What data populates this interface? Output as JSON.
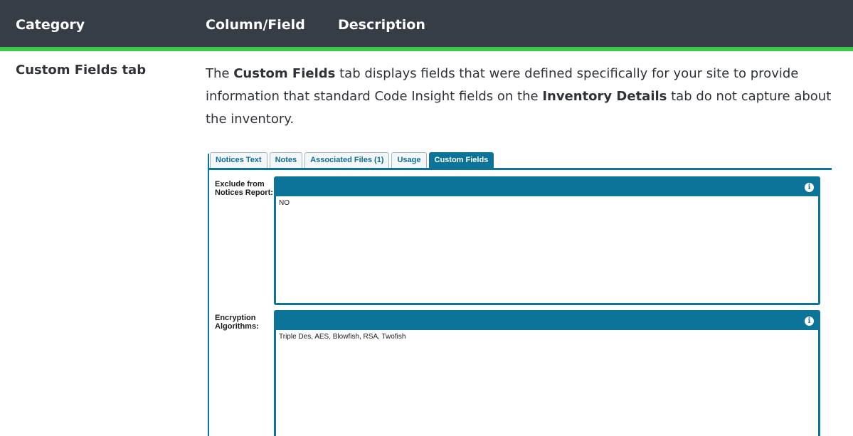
{
  "table": {
    "headers": [
      "Category",
      "Column/Field",
      "Description"
    ]
  },
  "row": {
    "category": "Custom Fields tab",
    "desc_parts": {
      "p1": "The ",
      "b1": "Custom Fields",
      "p2": " tab displays fields that were defined specifically for your site to provide information that standard Code Insight fields on the ",
      "b2": "Inventory Details",
      "p3": " tab do not capture about the inventory."
    }
  },
  "screenshot": {
    "tabs": [
      "Notices Text",
      "Notes",
      "Associated Files (1)",
      "Usage",
      "Custom Fields"
    ],
    "active_tab": "Custom Fields",
    "fields": [
      {
        "label_line1": "Exclude from",
        "label_line2": "Notices Report:",
        "value": "NO",
        "info_icon": "info-icon"
      },
      {
        "label_line1": "Encryption",
        "label_line2": "Algorithms:",
        "value": "Triple Des, AES, Blowfish, RSA, Twofish",
        "info_icon": "info-icon"
      }
    ],
    "info_glyph": "i"
  },
  "colors": {
    "header_bg": "#363d46",
    "header_accent": "#3ec84a",
    "brand_blue": "#0c7399"
  }
}
